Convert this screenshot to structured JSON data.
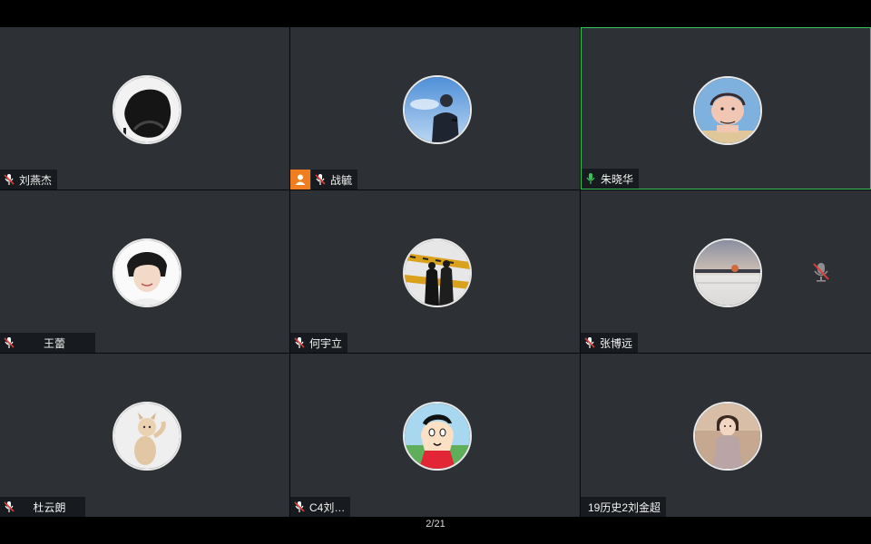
{
  "participants": [
    {
      "name": "刘燕杰",
      "mic": "muted"
    },
    {
      "name": "战毓",
      "mic": "muted",
      "host": true
    },
    {
      "name": "朱晓华",
      "mic": "speaking",
      "active": true
    },
    {
      "name": "王蕾",
      "mic": "muted"
    },
    {
      "name": "何宇立",
      "mic": "muted"
    },
    {
      "name": "张博远",
      "mic": "muted"
    },
    {
      "name": "杜云朗",
      "mic": "muted"
    },
    {
      "name": "C4刘…",
      "mic": "muted"
    },
    {
      "name": "19历史2刘金超",
      "mic": "none"
    }
  ],
  "pager": {
    "label": "2/21"
  },
  "colors": {
    "tile_bg": "#2d3035",
    "active_border": "#35c25a",
    "muted_mic": "#e23b3b",
    "speaking_mic": "#3bc15a",
    "host_badge": "#f07d1e"
  }
}
